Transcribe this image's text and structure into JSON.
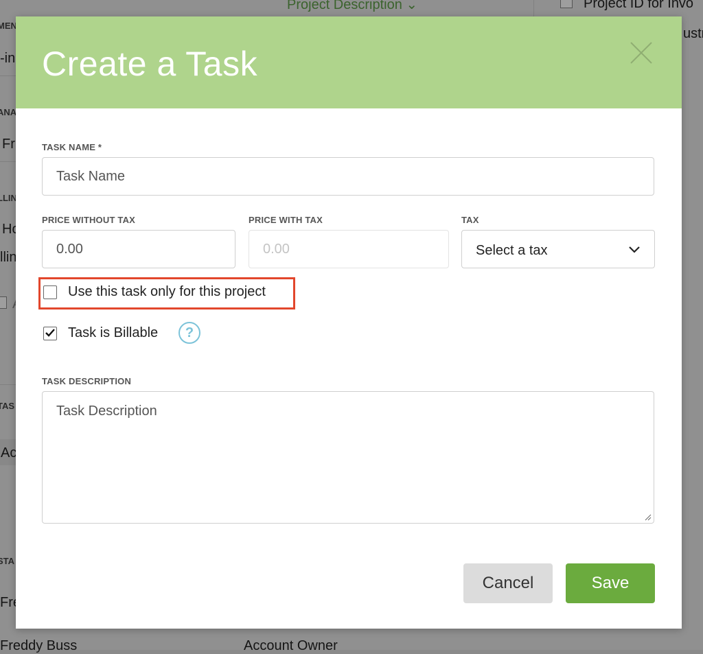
{
  "background": {
    "top_link": "Project Description",
    "top_right_checkbox_label": "Project ID for Invo",
    "right_partial_text": "ustr",
    "left_fragments": [
      "MEN",
      "-in",
      "ANA",
      "Fr",
      "LLIN",
      "Ho",
      "llin",
      "A",
      "TAS",
      "Ac",
      "STA",
      "Fre"
    ],
    "bottom_left": "Freddy Buss",
    "bottom_center": "Account Owner"
  },
  "modal": {
    "title": "Create a Task",
    "close_label": "×",
    "task_name": {
      "label": "TASK NAME *",
      "placeholder": "Task Name",
      "value": ""
    },
    "price_without_tax": {
      "label": "PRICE WITHOUT TAX",
      "placeholder": "0.00",
      "value": ""
    },
    "price_with_tax": {
      "label": "PRICE WITH TAX",
      "placeholder": "0.00",
      "value": ""
    },
    "tax": {
      "label": "TAX",
      "selected": "Select a tax"
    },
    "project_only": {
      "label": "Use this task only for this project",
      "checked": false
    },
    "billable": {
      "label": "Task is Billable",
      "checked": true,
      "help_symbol": "?"
    },
    "task_description": {
      "label": "TASK DESCRIPTION",
      "placeholder": "Task Description",
      "value": ""
    },
    "cancel_label": "Cancel",
    "save_label": "Save"
  },
  "colors": {
    "header": "#afd48c",
    "save": "#6bab3e",
    "cancel": "#dcdcdc",
    "highlight": "#e2462c",
    "help": "#7cc3d9"
  }
}
